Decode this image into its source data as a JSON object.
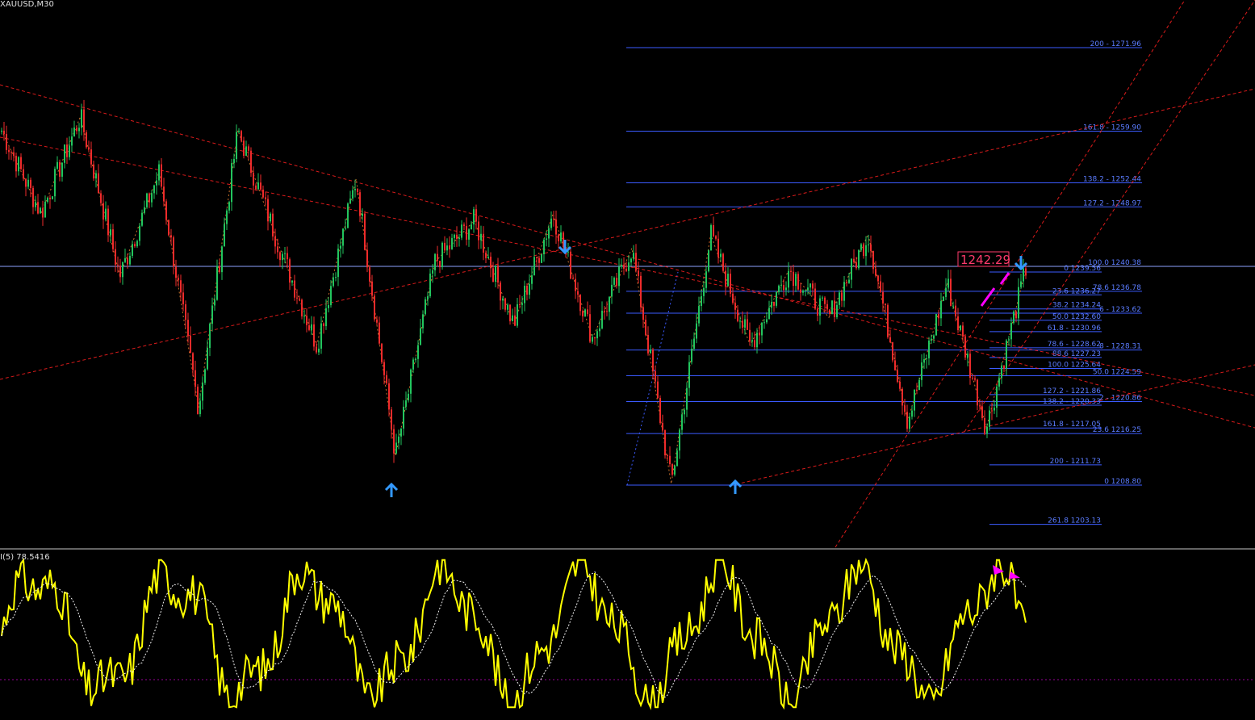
{
  "chart_data": {
    "type": "candlestick",
    "symbol_label": "XAUUSD,M30",
    "price_range": [
      1200,
      1278
    ],
    "current_price_label": "1242.29",
    "colors": {
      "bull": "#22c55e",
      "bear": "#ef2b2b",
      "fib": "#3b5bff",
      "trend": "#ff2020",
      "zigzag": "#c8702a",
      "wpr": "#ffff00",
      "signal": "#f5f5f5",
      "marker": "#3399ff",
      "alert": "#ff00ff"
    },
    "fib_main": [
      {
        "text": "200 - 1271.96",
        "price": 1271.96
      },
      {
        "text": "161.8 - 1259.90",
        "price": 1259.9
      },
      {
        "text": "138.2 - 1252.44",
        "price": 1252.44
      },
      {
        "text": "127.2 - 1248.97",
        "price": 1248.97
      },
      {
        "text": "100.0 1240.38",
        "price": 1240.38
      },
      {
        "text": "78.6 1236.78",
        "price": 1236.78
      },
      {
        "text": "6 - 1233.62",
        "price": 1233.62
      },
      {
        "text": "8 - 1228.31",
        "price": 1228.31
      },
      {
        "text": "50.0 1224.59",
        "price": 1224.59
      },
      {
        "text": "2 - 1220.86",
        "price": 1220.86
      },
      {
        "text": "23.6 1216.25",
        "price": 1216.25
      },
      {
        "text": "0 1208.80",
        "price": 1208.8
      }
    ],
    "fib_small": [
      {
        "text": "0 1239.56",
        "price": 1239.56
      },
      {
        "text": "23.6 1236.27",
        "price": 1236.27
      },
      {
        "text": "38.2 1234.24",
        "price": 1234.24
      },
      {
        "text": "50.0 1232.60",
        "price": 1232.6
      },
      {
        "text": "61.8 - 1230.96",
        "price": 1230.96
      },
      {
        "text": "78.6 - 1228.62",
        "price": 1228.62
      },
      {
        "text": "88.6 1227.23",
        "price": 1227.23
      },
      {
        "text": "100.0 1225.64",
        "price": 1225.64
      },
      {
        "text": "127.2 - 1221.86",
        "price": 1221.86
      },
      {
        "text": "138.2 - 1220.33",
        "price": 1220.33
      },
      {
        "text": "161.8 - 1217.05",
        "price": 1217.05
      },
      {
        "text": "200 - 1211.73",
        "price": 1211.73
      },
      {
        "text": "261.8 1203.13",
        "price": 1203.13
      }
    ],
    "swing_points": [
      1260,
      1248,
      1262,
      1239,
      1254,
      1220,
      1260,
      1244,
      1229,
      1253,
      1213,
      1241,
      1247,
      1232,
      1248,
      1230,
      1243,
      1209,
      1245,
      1229,
      1240,
      1233,
      1245,
      1218,
      1238,
      1217,
      1240
    ],
    "indicator": {
      "label": "I(5) 78.5416",
      "range": [
        0,
        100
      ],
      "level": 20
    }
  }
}
